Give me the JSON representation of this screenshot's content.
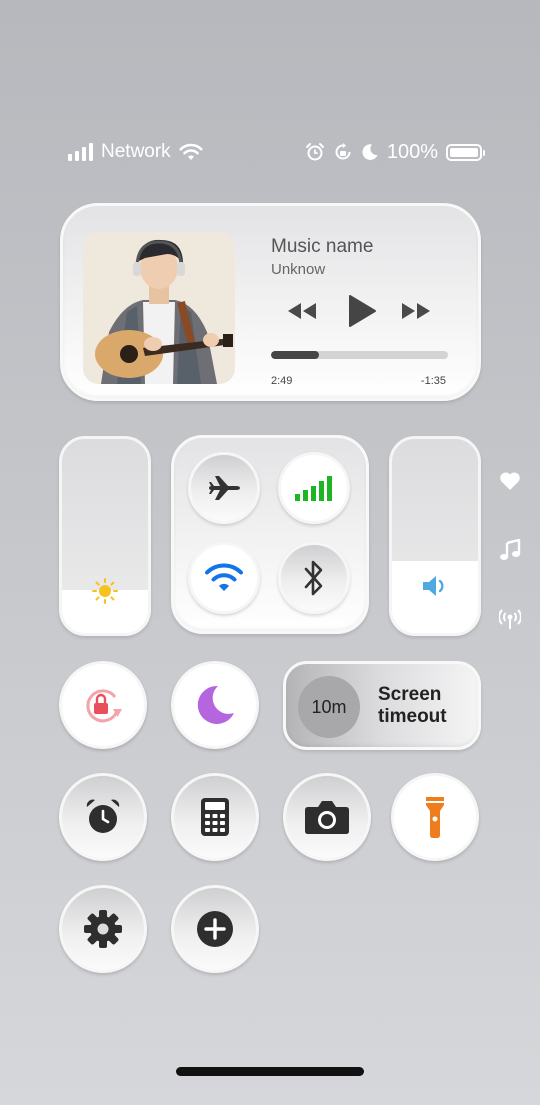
{
  "status_bar": {
    "network_label": "Network",
    "battery_text": "100%",
    "icons": [
      "signal-icon",
      "wifi-icon",
      "alarm-icon",
      "rotation-lock-icon",
      "moon-icon",
      "battery-icon"
    ]
  },
  "music": {
    "title": "Music name",
    "artist": "Unknow",
    "elapsed": "2:49",
    "remaining": "-1:35",
    "progress": 0.27,
    "controls": [
      "rewind-icon",
      "play-icon",
      "fast-forward-icon"
    ]
  },
  "brightness": {
    "level": 0.22,
    "icon": "sun-icon"
  },
  "volume": {
    "level": 0.37,
    "icon": "speaker-icon"
  },
  "connectivity": {
    "airplane": {
      "icon": "airplane-icon",
      "active": false
    },
    "cellular": {
      "icon": "cellular-icon",
      "active": true
    },
    "wifi": {
      "icon": "wifi-icon",
      "active": true
    },
    "bluetooth": {
      "icon": "bluetooth-icon",
      "active": false
    }
  },
  "screen_timeout": {
    "value": "10m",
    "label_line1": "Screen",
    "label_line2": "timeout"
  },
  "toggles": [
    {
      "icon": "rotation-lock-icon",
      "active": true
    },
    {
      "icon": "moon-icon",
      "active": true
    },
    {
      "icon": "alarm-icon",
      "active": false
    },
    {
      "icon": "calculator-icon",
      "active": false
    },
    {
      "icon": "camera-icon",
      "active": false
    },
    {
      "icon": "flashlight-icon",
      "active": true
    },
    {
      "icon": "settings-icon",
      "active": false
    },
    {
      "icon": "add-icon",
      "active": false
    }
  ],
  "side_icons": [
    "heart-icon",
    "music-note-icon",
    "broadcast-icon"
  ],
  "colors": {
    "cellular_green": "#1db523",
    "wifi_blue": "#1473e6",
    "moon_purple": "#b565dd",
    "rotation_red": "#e8505b",
    "flashlight_orange": "#f07d1c",
    "sun_yellow": "#f6c21c",
    "speaker_blue": "#4da9e0"
  }
}
